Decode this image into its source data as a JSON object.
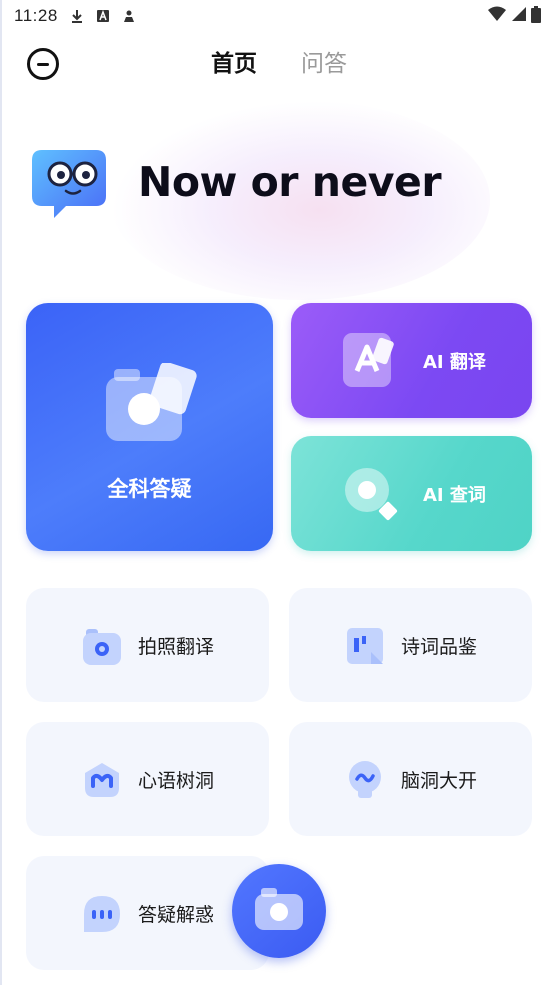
{
  "status_bar": {
    "time": "11:28",
    "icons": [
      "download-icon",
      "text-a-icon",
      "person-icon",
      "wifi-icon",
      "signal-icon",
      "battery-icon"
    ]
  },
  "header": {
    "tabs": [
      {
        "label": "首页",
        "active": true
      },
      {
        "label": "问答",
        "active": false
      }
    ],
    "back_icon": "exit-circle-icon"
  },
  "hero": {
    "title": "Now or never",
    "mascot": "chat-bubble-mascot"
  },
  "cards": {
    "main": {
      "label": "全科答疑",
      "icon": "camera-photo-icon"
    },
    "translate": {
      "label": "AI 翻译",
      "icon": "translate-a-icon"
    },
    "lookup": {
      "label": "AI 查词",
      "icon": "magnifier-icon"
    }
  },
  "tiles": [
    {
      "label": "拍照翻译",
      "icon": "camera-icon"
    },
    {
      "label": "诗词品鉴",
      "icon": "book-bookmark-icon"
    },
    {
      "label": "心语树洞",
      "icon": "heart-chat-icon"
    },
    {
      "label": "脑洞大开",
      "icon": "bulb-icon"
    },
    {
      "label": "答疑解惑",
      "icon": "chat-dots-icon"
    }
  ],
  "fab": {
    "icon": "camera-fab-icon"
  },
  "colors": {
    "primary_blue": "#3b63f7",
    "purple": "#8b52f6",
    "teal": "#56d7cb",
    "tile_bg": "#f3f6fd",
    "tab_inactive": "#9a9a9a"
  }
}
